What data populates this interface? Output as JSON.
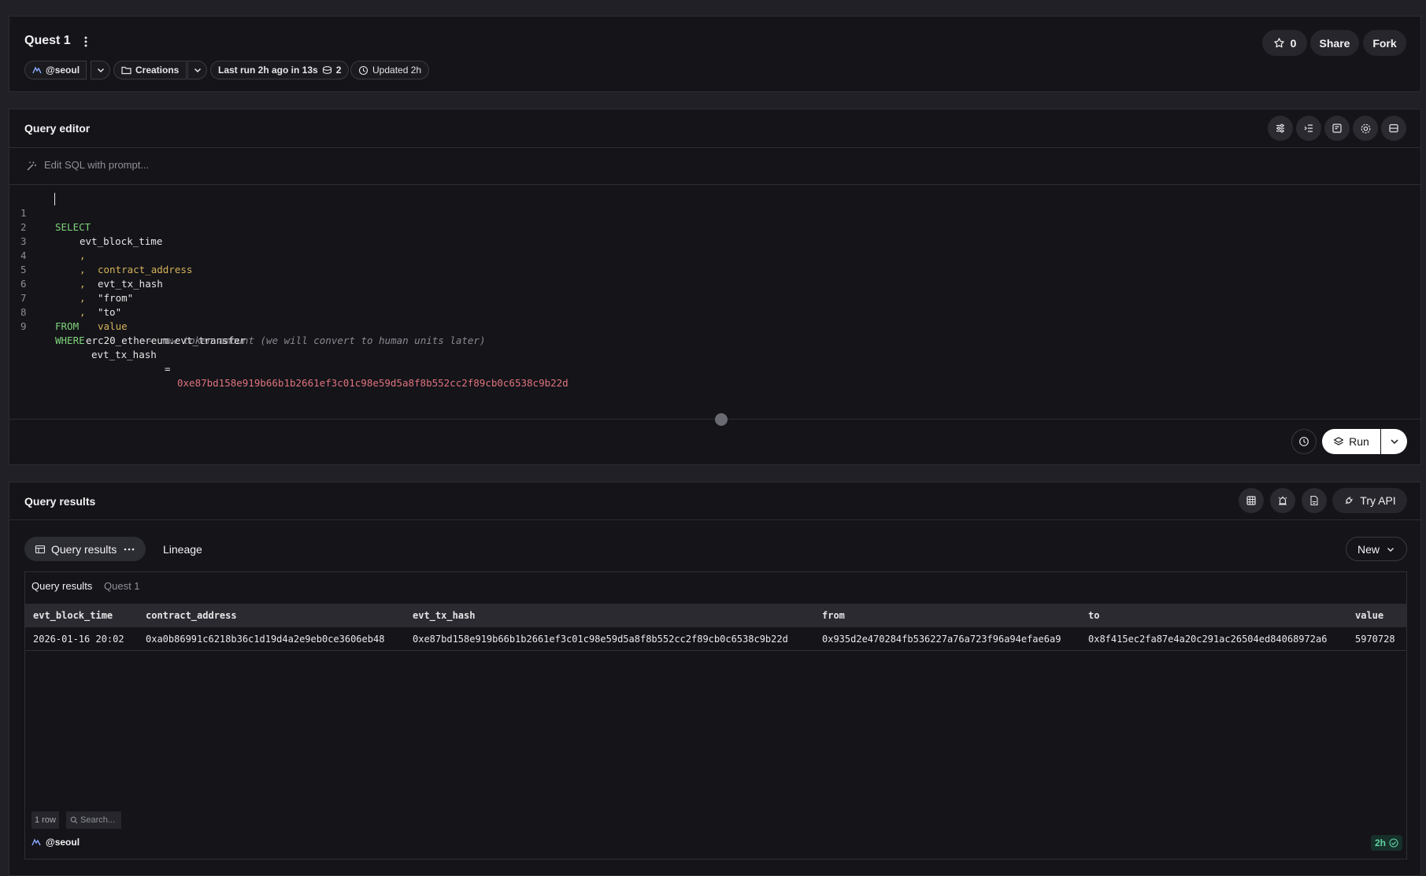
{
  "header": {
    "title": "Quest 1",
    "star_count": "0",
    "share_label": "Share",
    "fork_label": "Fork",
    "owner": "@seoul",
    "folder": "Creations",
    "last_run": "Last run 2h ago in 13s",
    "credits": "2",
    "updated": "Updated 2h"
  },
  "editor": {
    "title": "Query editor",
    "prompt_placeholder": "Edit SQL with prompt...",
    "run_label": "Run",
    "lines": [
      {
        "n": "1"
      },
      {
        "n": "2"
      },
      {
        "n": "3"
      },
      {
        "n": "4"
      },
      {
        "n": "5"
      },
      {
        "n": "6"
      },
      {
        "n": "7"
      },
      {
        "n": "8"
      },
      {
        "n": "9"
      }
    ],
    "tokens": {
      "select": "SELECT",
      "evt_block_time": "evt_block_time",
      "comma": ",",
      "contract_address": "contract_address",
      "evt_tx_hash": "evt_tx_hash",
      "from_q": "\"from\"",
      "to_q": "\"to\"",
      "value": "value",
      "comment": "-- raw token amount (we will convert to human units later)",
      "from_kw": "FROM",
      "table": "erc20_ethereum.evt_transfer",
      "where_kw": "WHERE",
      "where_col": "evt_tx_hash",
      "eq": "=",
      "hash": "0xe87bd158e919b66b1b2661ef3c01c98e59d5a8f8b552cc2f89cb0c6538c9b22d"
    }
  },
  "results": {
    "title": "Query results",
    "try_api_label": "Try API",
    "tab_results": "Query results",
    "tab_lineage": "Lineage",
    "new_label": "New",
    "table_title": "Query results",
    "table_subtitle": "Quest 1",
    "columns": [
      "evt_block_time",
      "contract_address",
      "evt_tx_hash",
      "from",
      "to",
      "value"
    ],
    "rows": [
      {
        "evt_block_time": "2026-01-16 20:02",
        "contract_address": "0xa0b86991c6218b36c1d19d4a2e9eb0ce3606eb48",
        "evt_tx_hash": "0xe87bd158e919b66b1b2661ef3c01c98e59d5a8f8b552cc2f89cb0c6538c9b22d",
        "from": "0x935d2e470284fb536227a76a723f96a94efae6a9",
        "to": "0x8f415ec2fa87e4a20c291ac26504ed84068972a6",
        "value": "5970728"
      }
    ],
    "row_count": "1 row",
    "search_placeholder": "Search...",
    "owner": "@seoul",
    "age": "2h"
  }
}
